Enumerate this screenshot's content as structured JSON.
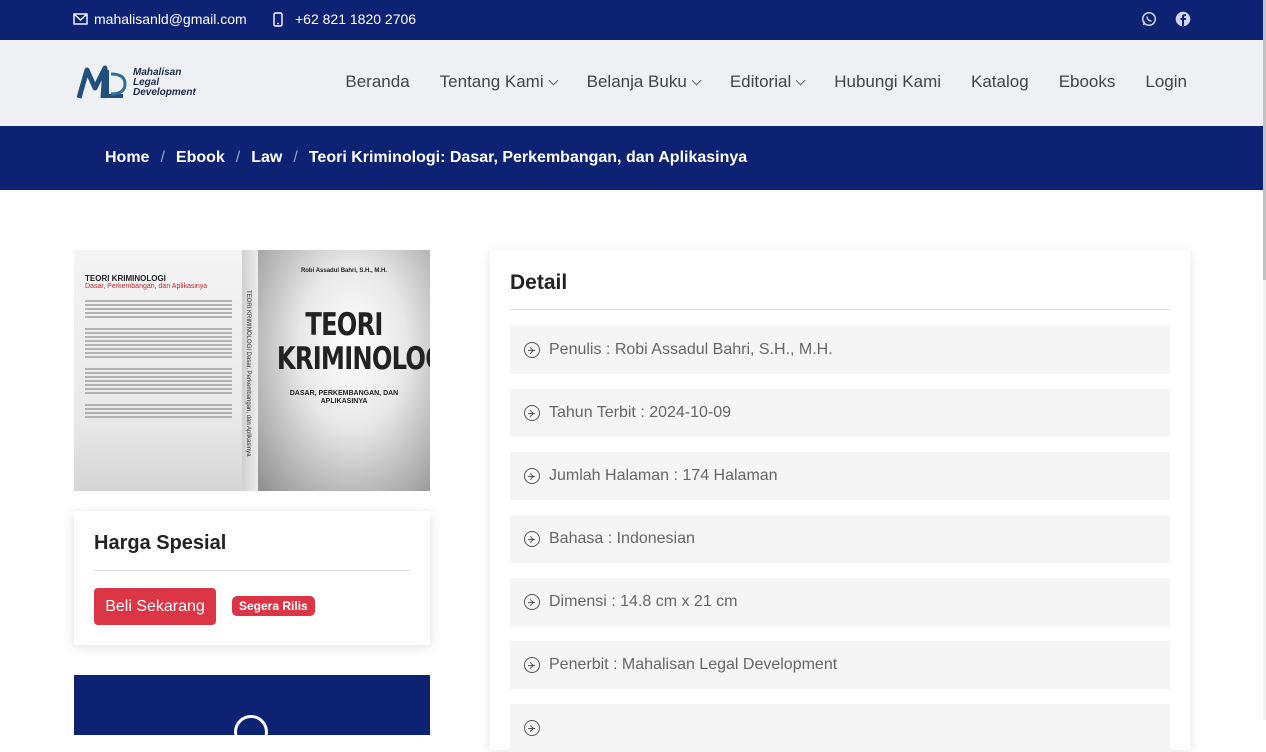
{
  "topbar": {
    "email": "mahalisanld@gmail.com",
    "phone": "+62 821 1820 2706",
    "icons": [
      "mail-icon",
      "phone-icon",
      "whatsapp-icon",
      "facebook-icon"
    ]
  },
  "logo": {
    "line1": "Mahalisan",
    "line2": "Legal",
    "line3": "Development"
  },
  "nav": [
    {
      "label": "Beranda",
      "dropdown": false
    },
    {
      "label": "Tentang Kami",
      "dropdown": true
    },
    {
      "label": "Belanja Buku",
      "dropdown": true
    },
    {
      "label": "Editorial",
      "dropdown": true
    },
    {
      "label": "Hubungi Kami",
      "dropdown": false
    },
    {
      "label": "Katalog",
      "dropdown": false
    },
    {
      "label": "Ebooks",
      "dropdown": false
    },
    {
      "label": "Login",
      "dropdown": false
    }
  ],
  "breadcrumb": [
    "Home",
    "Ebook",
    "Law",
    "Teori Kriminologi: Dasar, Perkembangan, dan Aplikasinya"
  ],
  "cover": {
    "back_title": "TEORI KRIMINOLOGI",
    "back_subtitle": "Dasar, Perkembangan, dan Aplikasinya",
    "spine": "TEORI KRIMINOLOGI  Dasar, Perkembangan, dan Aplikasinya",
    "author": "Robi Assadul Bahri, S.H., M.H.",
    "title_line1": "TEORI",
    "title_line2": "KRIMINOLOGI",
    "subtitle": "DASAR, PERKEMBANGAN, DAN APLIKASINYA"
  },
  "price": {
    "heading": "Harga Spesial",
    "buy_label": "Beli Sekarang",
    "badge": "Segera Rilis"
  },
  "detail": {
    "heading": "Detail",
    "rows": [
      "Penulis : Robi Assadul Bahri, S.H., M.H.",
      "Tahun Terbit : 2024-10-09",
      "Jumlah Halaman : 174 Halaman",
      "Bahasa : Indonesian",
      "Dimensi : 14.8 cm x 21 cm",
      "Penerbit : Mahalisan Legal Development"
    ]
  },
  "colors": {
    "navy": "#0e2273",
    "accent_red": "#dc3545",
    "header_bg": "#eef0f4"
  }
}
